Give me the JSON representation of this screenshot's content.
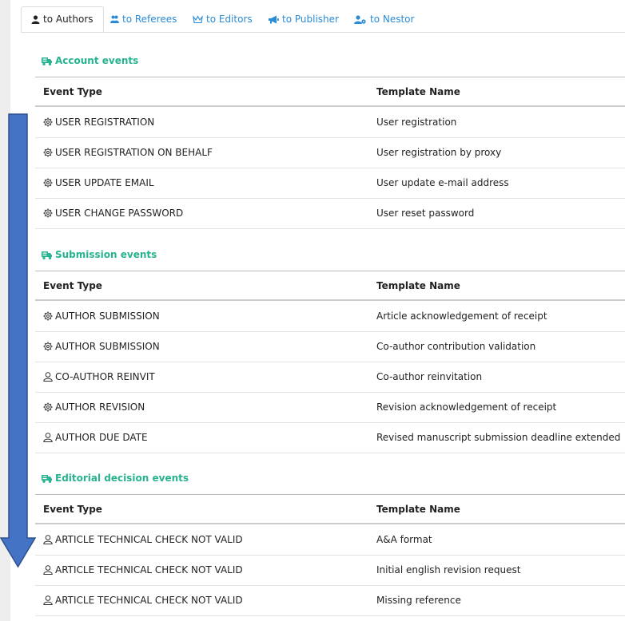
{
  "tabs": [
    {
      "label": "to Authors",
      "icon": "user-icon",
      "active": true
    },
    {
      "label": "to Referees",
      "icon": "users-icon",
      "active": false
    },
    {
      "label": "to Editors",
      "icon": "crown-icon",
      "active": false
    },
    {
      "label": "to Publisher",
      "icon": "megaphone-icon",
      "active": false
    },
    {
      "label": "to Nestor",
      "icon": "user-gear-icon",
      "active": false
    }
  ],
  "columns": {
    "event_type": "Event Type",
    "template_name": "Template Name"
  },
  "sections": [
    {
      "title": "Account events",
      "rows": [
        {
          "event": "USER REGISTRATION",
          "icon": "gear-icon",
          "template": "User registration"
        },
        {
          "event": "USER REGISTRATION ON BEHALF",
          "icon": "gear-icon",
          "template": "User registration by proxy"
        },
        {
          "event": "USER UPDATE EMAIL",
          "icon": "gear-icon",
          "template": "User update e-mail address"
        },
        {
          "event": "USER CHANGE PASSWORD",
          "icon": "gear-icon",
          "template": "User reset password"
        }
      ]
    },
    {
      "title": "Submission events",
      "rows": [
        {
          "event": "AUTHOR SUBMISSION",
          "icon": "gear-icon",
          "template": "Article acknowledgement of receipt"
        },
        {
          "event": "AUTHOR SUBMISSION",
          "icon": "gear-icon",
          "template": "Co-author contribution validation"
        },
        {
          "event": "CO-AUTHOR REINVIT",
          "icon": "person-icon",
          "template": "Co-author reinvitation"
        },
        {
          "event": "AUTHOR REVISION",
          "icon": "gear-icon",
          "template": "Revision acknowledgement of receipt"
        },
        {
          "event": "AUTHOR DUE DATE",
          "icon": "person-icon",
          "template": "Revised manuscript submission deadline extended"
        }
      ]
    },
    {
      "title": "Editorial decision events",
      "rows": [
        {
          "event": "ARTICLE TECHNICAL CHECK NOT VALID",
          "icon": "person-icon",
          "template": "A&A format"
        },
        {
          "event": "ARTICLE TECHNICAL CHECK NOT VALID",
          "icon": "person-icon",
          "template": "Initial english revision request"
        },
        {
          "event": "ARTICLE TECHNICAL CHECK NOT VALID",
          "icon": "person-icon",
          "template": "Missing reference"
        }
      ]
    }
  ],
  "colors": {
    "accent": "#27b38f",
    "link": "#2a8bd6",
    "arrow_fill": "#4472c4",
    "arrow_stroke": "#2f528f"
  }
}
